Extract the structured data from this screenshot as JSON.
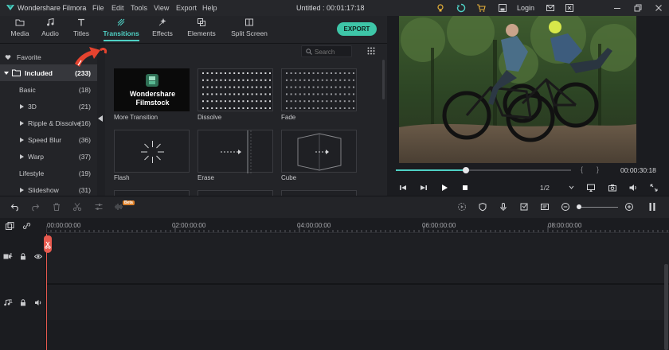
{
  "app": {
    "name": "Wondershare Filmora",
    "menu": [
      "File",
      "Edit",
      "Tools",
      "View",
      "Export",
      "Help"
    ],
    "document_title": "Untitled : 00:01:17:18",
    "login_label": "Login",
    "accent_color": "#4fd1c5",
    "export_color": "#3ec6a8"
  },
  "tabs": [
    {
      "label": "Media",
      "icon": "folder-icon"
    },
    {
      "label": "Audio",
      "icon": "music-note-icon"
    },
    {
      "label": "Titles",
      "icon": "text-t-icon"
    },
    {
      "label": "Transitions",
      "icon": "transition-icon",
      "active": true
    },
    {
      "label": "Effects",
      "icon": "effects-icon"
    },
    {
      "label": "Elements",
      "icon": "elements-icon"
    },
    {
      "label": "Split Screen",
      "icon": "split-screen-icon"
    }
  ],
  "export_label": "EXPORT",
  "sidebar": {
    "favorite": "Favorite",
    "included": {
      "label": "Included",
      "count": "(233)"
    },
    "items": [
      {
        "label": "Basic",
        "count": "(18)"
      },
      {
        "label": "3D",
        "count": "(21)"
      },
      {
        "label": "Ripple & Dissolve",
        "count": "(16)"
      },
      {
        "label": "Speed Blur",
        "count": "(36)"
      },
      {
        "label": "Warp",
        "count": "(37)"
      },
      {
        "label": "Lifestyle",
        "count": "(19)"
      },
      {
        "label": "Slideshow",
        "count": "(31)"
      }
    ]
  },
  "search": {
    "placeholder": "Search"
  },
  "grid": {
    "filmstock": {
      "line1": "Wondershare",
      "line2": "Filmstock",
      "label": "More Transition"
    },
    "items": [
      {
        "label": "Dissolve"
      },
      {
        "label": "Fade"
      },
      {
        "label": "Flash"
      },
      {
        "label": "Erase"
      },
      {
        "label": "Cube"
      }
    ]
  },
  "preview": {
    "progress": 0.4,
    "time": "00:00:30:18",
    "ratio": "1/2",
    "brace_left": "{",
    "brace_right": "}"
  },
  "toolbar": {
    "beta": "Beta"
  },
  "timeline": {
    "ticks": [
      "00:00:00:00",
      "02:00:00:00",
      "04:00:00:00",
      "06:00:00:00",
      "08:00:00:00"
    ],
    "video_track_label": "1",
    "audio_track_label": "1"
  }
}
